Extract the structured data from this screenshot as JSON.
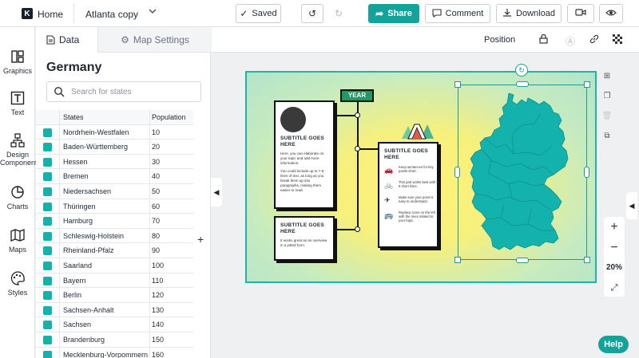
{
  "topbar": {
    "home_label": "Home",
    "doc_title": "Atlanta copy",
    "saved_label": "Saved",
    "share_label": "Share",
    "comment_label": "Comment",
    "download_label": "Download"
  },
  "rail": {
    "items": [
      {
        "label": "Graphics",
        "icon": "graphics-icon"
      },
      {
        "label": "Text",
        "icon": "text-icon"
      },
      {
        "label": "Design Components",
        "icon": "design-components-icon"
      },
      {
        "label": "Charts",
        "icon": "charts-icon"
      },
      {
        "label": "Maps",
        "icon": "maps-icon"
      },
      {
        "label": "Styles",
        "icon": "styles-icon"
      }
    ]
  },
  "panel": {
    "tabs": {
      "data": "Data",
      "map_settings": "Map Settings"
    },
    "title": "Germany",
    "search_placeholder": "Search for states",
    "columns": {
      "state": "States",
      "population": "Population"
    },
    "rows": [
      {
        "state": "Nordrhein-Westfalen",
        "population": "10"
      },
      {
        "state": "Baden-Württemberg",
        "population": "20"
      },
      {
        "state": "Hessen",
        "population": "30"
      },
      {
        "state": "Bremen",
        "population": "40"
      },
      {
        "state": "Niedersachsen",
        "population": "50"
      },
      {
        "state": "Thüringen",
        "population": "60"
      },
      {
        "state": "Hamburg",
        "population": "70"
      },
      {
        "state": "Schleswig-Holstein",
        "population": "80"
      },
      {
        "state": "Rheinland-Pfalz",
        "population": "90"
      },
      {
        "state": "Saarland",
        "population": "100"
      },
      {
        "state": "Bayern",
        "population": "110"
      },
      {
        "state": "Berlin",
        "population": "120"
      },
      {
        "state": "Sachsen-Anhalt",
        "population": "130"
      },
      {
        "state": "Sachsen",
        "population": "140"
      },
      {
        "state": "Brandenburg",
        "population": "150"
      },
      {
        "state": "Mecklenburg-Vorpommern",
        "population": "160"
      }
    ],
    "swatch_color": "#14b2ac"
  },
  "props": {
    "position_label": "Position"
  },
  "canvas": {
    "year_tag": "YEAR",
    "card1": {
      "subtitle": "SUBTITLE GOES HERE",
      "body1": "Here, you can elaborate on your topic and add more information.",
      "body2": "You could include up to 7-8 lines of text, as long as you break them up into paragraphs, making them easier to read."
    },
    "card2": {
      "subtitle": "SUBTITLE GOES HERE",
      "body": "It works great as an overview in a jotted form."
    },
    "card3": {
      "subtitle": "SUBTITLE GOES HERE",
      "rows": [
        "Keep sentences for key points short.",
        "This part works best with 3-5 short lines.",
        "Make sure your point is easy to understand.",
        "Replace icons on the left with the ones related to your topic."
      ]
    },
    "map_color": "#14b2ac",
    "accent_color": "#14a39a"
  },
  "zoom": {
    "level": "20%"
  },
  "help_label": "Help"
}
